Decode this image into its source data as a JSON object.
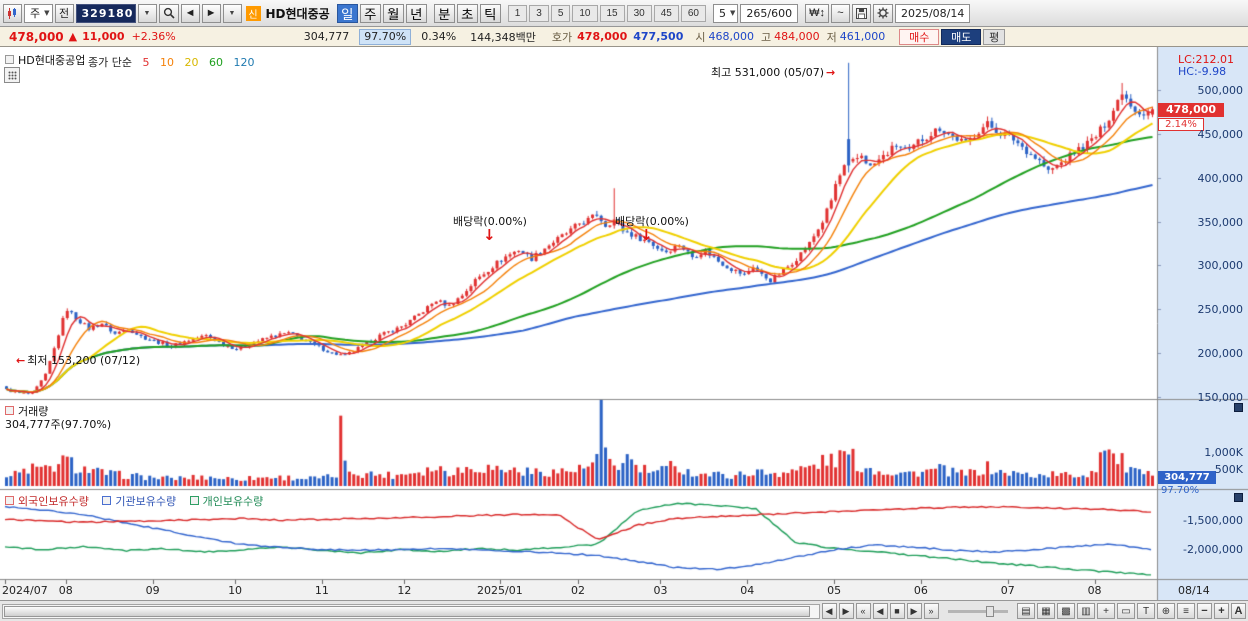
{
  "toolbar": {
    "chart_type_label": "주",
    "prev_button": "전",
    "code_value": "329180",
    "new_badge": "신",
    "stock_name": "HD현대중공",
    "period_tabs": [
      "일",
      "주",
      "월",
      "년"
    ],
    "subperiod_tabs": [
      "분",
      "초",
      "틱"
    ],
    "minute_buttons": [
      "1",
      "3",
      "5",
      "10",
      "15",
      "30",
      "45",
      "60"
    ],
    "interval_value": "5",
    "range_display": "265/600",
    "won_icon_label": "₩↕",
    "wave_icon_label": "~",
    "date_value": "2025/08/14"
  },
  "info_bar": {
    "price": "478,000",
    "arrow": "▲",
    "change": "11,000",
    "change_pct": "+2.36%",
    "volume": "304,777",
    "vol_ratio": "97.70%",
    "turnover": "0.34%",
    "value": "144,348백만",
    "hoga_label": "호가",
    "ask": "478,000",
    "bid": "477,500",
    "open_label": "시",
    "open": "468,000",
    "high_label": "고",
    "high": "484,000",
    "low_label": "저",
    "low": "461,000",
    "buy_btn": "매수",
    "sell_btn": "매도",
    "avg_btn": "평"
  },
  "price_panel": {
    "title": "HD현대중공업",
    "legend_prefix": "종가 단순",
    "ma_labels": [
      "5",
      "10",
      "20",
      "60",
      "120"
    ],
    "lc_label": "LC:212.01",
    "hc_label": "HC:-9.98",
    "high_annotation": "최고 531,000 (05/07)",
    "high_arrow": "→",
    "low_annotation": "최저 153,200 (07/12)",
    "low_arrow": "←",
    "ex_div_1": "배당락(0.00%)",
    "ex_div_2": "배당락(0.00%)",
    "ex_div_arrow": "↓",
    "price_badge": "478,000",
    "pct_badge": "2.14%"
  },
  "volume_panel": {
    "title": "거래량",
    "subtitle": "304,777주(97.70%)",
    "badge": "304,777",
    "badge_sub": "97.70%"
  },
  "holdings_panel": {
    "titles": [
      "외국인보유수량",
      "기관보유수량",
      "개인보유수량"
    ]
  },
  "x_axis": {
    "end_label": "08/14"
  },
  "bottom_bar": {
    "nav_buttons": [
      "«",
      "◀",
      "■",
      "▶",
      "»"
    ],
    "scroll_left": "◀",
    "scroll_right": "▶",
    "tool_icons": [
      {
        "name": "region-stat-icon",
        "glyph": "▤"
      },
      {
        "name": "grid-icon",
        "glyph": "▦"
      },
      {
        "name": "pattern-search-icon",
        "glyph": "▩"
      },
      {
        "name": "multi-chart-icon",
        "glyph": "▥"
      },
      {
        "name": "crosshair-icon",
        "glyph": "+"
      },
      {
        "name": "ruler-icon",
        "glyph": "▭"
      },
      {
        "name": "text-tool-icon",
        "glyph": "T"
      },
      {
        "name": "magnifier-icon",
        "glyph": "⊕"
      },
      {
        "name": "menu-icon",
        "glyph": "≡"
      }
    ],
    "zoom_out": "−",
    "zoom_in": "+",
    "auto_label": "A"
  },
  "colors": {
    "up": "#e13131",
    "down": "#2b62c5",
    "ma5": "#e13131",
    "ma10": "#f5820b",
    "ma20": "#f0d000",
    "ma60": "#22a122",
    "ma120": "#3466cf",
    "foreign": "#d92b2b",
    "inst": "#3466cf",
    "indiv": "#1f9e5a",
    "axis_bg": "#d8e6f7"
  },
  "chart_data": {
    "type": "candlestick",
    "title": "HD현대중공업 일봉",
    "price": {
      "ylim": [
        149000,
        543000
      ],
      "ticks": [
        500000,
        450000,
        400000,
        350000,
        300000,
        250000,
        200000,
        150000
      ],
      "months": [
        [
          "2024/07",
          0
        ],
        [
          "08",
          14
        ],
        [
          "09",
          34
        ],
        [
          "10",
          53
        ],
        [
          "11",
          73
        ],
        [
          "12",
          92
        ],
        [
          "2025/01",
          114
        ],
        [
          "02",
          132
        ],
        [
          "03",
          151
        ],
        [
          "04",
          171
        ],
        [
          "05",
          191
        ],
        [
          "06",
          211
        ],
        [
          "07",
          231
        ],
        [
          "08",
          251
        ]
      ],
      "close_anchors": [
        [
          0,
          158000
        ],
        [
          3,
          154500
        ],
        [
          6,
          153500
        ],
        [
          9,
          175000
        ],
        [
          11,
          205000
        ],
        [
          13,
          238000
        ],
        [
          14,
          250000
        ],
        [
          16,
          240000
        ],
        [
          19,
          228000
        ],
        [
          22,
          234000
        ],
        [
          25,
          222000
        ],
        [
          28,
          228000
        ],
        [
          31,
          219000
        ],
        [
          34,
          214000
        ],
        [
          38,
          208000
        ],
        [
          42,
          215000
        ],
        [
          46,
          220000
        ],
        [
          50,
          210000
        ],
        [
          53,
          205000
        ],
        [
          57,
          212000
        ],
        [
          61,
          219000
        ],
        [
          65,
          223000
        ],
        [
          69,
          214000
        ],
        [
          72,
          207000
        ],
        [
          75,
          200000
        ],
        [
          78,
          197000
        ],
        [
          82,
          208000
        ],
        [
          86,
          220000
        ],
        [
          90,
          228000
        ],
        [
          92,
          233000
        ],
        [
          96,
          248000
        ],
        [
          99,
          260000
        ],
        [
          102,
          254000
        ],
        [
          105,
          266000
        ],
        [
          108,
          283000
        ],
        [
          111,
          295000
        ],
        [
          113,
          303000
        ],
        [
          115,
          310000
        ],
        [
          118,
          318000
        ],
        [
          121,
          308000
        ],
        [
          124,
          320000
        ],
        [
          127,
          330000
        ],
        [
          130,
          340000
        ],
        [
          132,
          348000
        ],
        [
          134,
          352000
        ],
        [
          136,
          358000
        ],
        [
          138,
          346000
        ],
        [
          140,
          352000
        ],
        [
          142,
          340000
        ],
        [
          145,
          333000
        ],
        [
          148,
          327000
        ],
        [
          150,
          320000
        ],
        [
          152,
          316000
        ],
        [
          155,
          324000
        ],
        [
          158,
          310000
        ],
        [
          161,
          317000
        ],
        [
          164,
          305000
        ],
        [
          167,
          296000
        ],
        [
          170,
          289000
        ],
        [
          172,
          299000
        ],
        [
          174,
          289000
        ],
        [
          176,
          283000
        ],
        [
          179,
          294000
        ],
        [
          182,
          308000
        ],
        [
          185,
          325000
        ],
        [
          188,
          350000
        ],
        [
          190,
          374000
        ],
        [
          191,
          392000
        ],
        [
          193,
          412000
        ],
        [
          195,
          418000
        ],
        [
          197,
          426000
        ],
        [
          199,
          412000
        ],
        [
          202,
          424000
        ],
        [
          205,
          437000
        ],
        [
          208,
          429000
        ],
        [
          210,
          441000
        ],
        [
          212,
          447000
        ],
        [
          215,
          457000
        ],
        [
          218,
          447000
        ],
        [
          221,
          439000
        ],
        [
          224,
          454000
        ],
        [
          226,
          461000
        ],
        [
          229,
          451000
        ],
        [
          232,
          444000
        ],
        [
          235,
          431000
        ],
        [
          238,
          419000
        ],
        [
          240,
          407000
        ],
        [
          243,
          417000
        ],
        [
          246,
          429000
        ],
        [
          249,
          439000
        ],
        [
          251,
          447000
        ],
        [
          253,
          461000
        ],
        [
          255,
          477000
        ],
        [
          257,
          499000
        ],
        [
          258,
          491000
        ],
        [
          260,
          478000
        ],
        [
          262,
          473000
        ],
        [
          264,
          478000
        ]
      ],
      "specials": [
        {
          "day": 6,
          "low": 153200
        },
        {
          "day": 140,
          "high": 388000
        },
        {
          "day": 194,
          "open": 444000,
          "close": 414000,
          "high": 531000,
          "low": 406000
        },
        {
          "day": 257,
          "high": 508000
        },
        {
          "day": 264,
          "open": 472000,
          "close": 478000,
          "high": 481000,
          "low": 469000
        }
      ],
      "high_marker": {
        "day": 194,
        "price": 531000,
        "label": "최고 531,000 (05/07)"
      },
      "low_marker": {
        "day": 6,
        "price": 153200,
        "label": "최저 153,200 (07/12)"
      }
    },
    "volume": {
      "unit": "K",
      "ticks": [
        {
          "v": 1000,
          "label": "1,000K"
        },
        {
          "v": 500,
          "label": "500K"
        }
      ],
      "last": 304.777,
      "anchors": [
        [
          0,
          260
        ],
        [
          3,
          380
        ],
        [
          6,
          520
        ],
        [
          9,
          460
        ],
        [
          11,
          560
        ],
        [
          13,
          680
        ],
        [
          14,
          720
        ],
        [
          16,
          560
        ],
        [
          19,
          450
        ],
        [
          22,
          380
        ],
        [
          25,
          330
        ],
        [
          28,
          300
        ],
        [
          31,
          270
        ],
        [
          34,
          240
        ],
        [
          38,
          215
        ],
        [
          42,
          240
        ],
        [
          46,
          260
        ],
        [
          50,
          225
        ],
        [
          53,
          205
        ],
        [
          57,
          230
        ],
        [
          61,
          255
        ],
        [
          65,
          240
        ],
        [
          69,
          215
        ],
        [
          72,
          225
        ],
        [
          75,
          260
        ],
        [
          76,
          320
        ],
        [
          77,
          1650
        ],
        [
          78,
          560
        ],
        [
          80,
          400
        ],
        [
          82,
          360
        ],
        [
          86,
          330
        ],
        [
          90,
          310
        ],
        [
          92,
          380
        ],
        [
          96,
          450
        ],
        [
          99,
          520
        ],
        [
          102,
          430
        ],
        [
          105,
          470
        ],
        [
          108,
          550
        ],
        [
          111,
          520
        ],
        [
          113,
          500
        ],
        [
          115,
          470
        ],
        [
          118,
          440
        ],
        [
          121,
          390
        ],
        [
          124,
          420
        ],
        [
          127,
          410
        ],
        [
          130,
          440
        ],
        [
          132,
          470
        ],
        [
          134,
          520
        ],
        [
          136,
          760
        ],
        [
          137,
          1900
        ],
        [
          138,
          860
        ],
        [
          140,
          640
        ],
        [
          142,
          560
        ],
        [
          143,
          900
        ],
        [
          145,
          520
        ],
        [
          148,
          430
        ],
        [
          150,
          390
        ],
        [
          152,
          470
        ],
        [
          154,
          700
        ],
        [
          156,
          430
        ],
        [
          158,
          380
        ],
        [
          161,
          340
        ],
        [
          164,
          320
        ],
        [
          167,
          300
        ],
        [
          170,
          340
        ],
        [
          172,
          420
        ],
        [
          174,
          380
        ],
        [
          176,
          360
        ],
        [
          179,
          410
        ],
        [
          182,
          450
        ],
        [
          185,
          540
        ],
        [
          188,
          680
        ],
        [
          190,
          760
        ],
        [
          191,
          780
        ],
        [
          193,
          860
        ],
        [
          194,
          960
        ],
        [
          196,
          620
        ],
        [
          199,
          490
        ],
        [
          202,
          430
        ],
        [
          205,
          390
        ],
        [
          208,
          365
        ],
        [
          210,
          400
        ],
        [
          212,
          420
        ],
        [
          215,
          480
        ],
        [
          218,
          385
        ],
        [
          221,
          340
        ],
        [
          224,
          430
        ],
        [
          226,
          520
        ],
        [
          229,
          390
        ],
        [
          232,
          360
        ],
        [
          235,
          325
        ],
        [
          238,
          305
        ],
        [
          240,
          340
        ],
        [
          243,
          320
        ],
        [
          246,
          305
        ],
        [
          249,
          340
        ],
        [
          251,
          520
        ],
        [
          252,
          920
        ],
        [
          253,
          1500
        ],
        [
          254,
          1020
        ],
        [
          255,
          820
        ],
        [
          257,
          700
        ],
        [
          258,
          520
        ],
        [
          260,
          390
        ],
        [
          262,
          330
        ],
        [
          264,
          305
        ]
      ]
    },
    "holdings": {
      "ticks": [
        -1500000,
        -2000000
      ],
      "foreign": [
        -1500000,
        -1520000,
        -1550000,
        -1530000,
        -1520000,
        -1500000,
        -1480000,
        -1510000,
        -1500000,
        -1480000,
        -1470000,
        -1450000,
        -1430000,
        -1415000,
        -1420000,
        -1850000,
        -1600000,
        -1480000,
        -1450000,
        -1420000,
        -1390000,
        -1360000,
        -1330000,
        -1310000,
        -1290000,
        -1285000,
        -1295000,
        -1315000,
        -1330000,
        -1370000
      ],
      "institutional": [
        -1280000,
        -1340000,
        -1420000,
        -1550000,
        -1680000,
        -1820000,
        -1930000,
        -1980000,
        -2020000,
        -2030000,
        -2020000,
        -2000000,
        -2020000,
        -2050000,
        -2080000,
        -2120000,
        -2220000,
        -2330000,
        -2360000,
        -2280000,
        -2150000,
        -2020000,
        -1940000,
        -1980000,
        -2030000,
        -2060000,
        -2020000,
        -1970000,
        -1920000,
        -2010000
      ],
      "individual": [
        -1980000,
        -2020000,
        -1970000,
        -2040000,
        -2000000,
        -2060000,
        -2020000,
        -1980000,
        -2030000,
        -2080000,
        -2020000,
        -2050000,
        -2000000,
        -2030000,
        -1980000,
        -1930000,
        -1350000,
        -1220000,
        -1260000,
        -1310000,
        -1900000,
        -2000000,
        -2050000,
        -2120000,
        -2180000,
        -2250000,
        -2300000,
        -2360000,
        -2410000,
        -2450000
      ]
    }
  }
}
